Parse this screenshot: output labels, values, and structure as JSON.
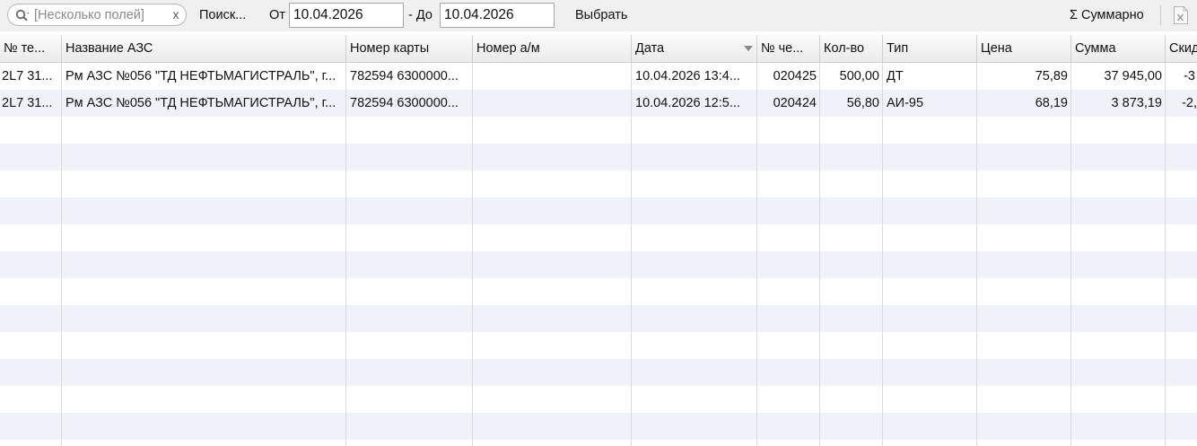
{
  "toolbar": {
    "search_placeholder": "[Несколько полей]",
    "clear_label": "x",
    "search_label": "Поиск...",
    "from_label": "От",
    "date_from": "10.04.2026",
    "to_label": "- До",
    "date_to": "10.04.2026",
    "select_label": "Выбрать",
    "summary_label": "Σ Суммарно",
    "icons": {
      "search": "search-icon",
      "export": "excel-export-icon"
    }
  },
  "table": {
    "columns": [
      "№ те...",
      "Название АЗС",
      "Номер карты",
      "Номер а/м",
      "Дата",
      "№ че...",
      "Кол-во",
      "Тип",
      "Цена",
      "Сумма",
      "Скид"
    ],
    "sorted_column": "Дата",
    "rows": [
      {
        "terminal": "2L7 31...",
        "station": "Рм АЗС №056 \"ТД НЕФТЬМАГИСТРАЛЬ\", г...",
        "card": "782594 6300000...",
        "vehicle": "",
        "date": "10.04.2026 13:4...",
        "check": "020425",
        "qty": "500,00",
        "type": "ДТ",
        "price": "75,89",
        "sum": "37 945,00",
        "discount": "-3"
      },
      {
        "terminal": "2L7 31...",
        "station": "Рм АЗС №056 \"ТД НЕФТЬМАГИСТРАЛЬ\", г...",
        "card": "782594 6300000...",
        "vehicle": "",
        "date": "10.04.2026 12:5...",
        "check": "020424",
        "qty": "56,80",
        "type": "АИ-95",
        "price": "68,19",
        "sum": "3 873,19",
        "discount": "-2,"
      }
    ]
  },
  "colors": {
    "toolbar_bg": "#f0f0f0",
    "row_alt_bg": "#eff3f9",
    "header_bg": "#f4f4f4",
    "grid_line": "#dadada"
  }
}
